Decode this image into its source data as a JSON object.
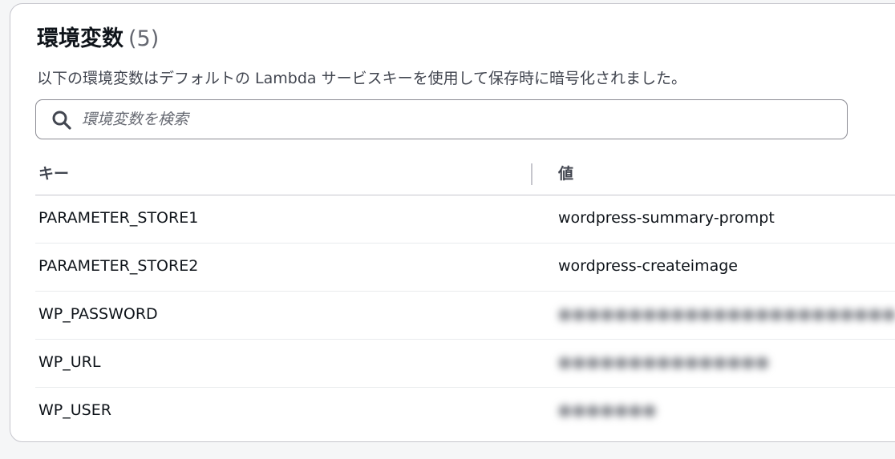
{
  "section": {
    "title": "環境変数",
    "count": "(5)",
    "description": "以下の環境変数はデフォルトの Lambda サービスキーを使用して保存時に暗号化されました。"
  },
  "search": {
    "placeholder": "環境変数を検索",
    "value": ""
  },
  "table": {
    "columns": [
      "キー",
      "値"
    ],
    "rows": [
      {
        "key": "PARAMETER_STORE1",
        "value": "wordpress-summary-prompt",
        "redacted": false
      },
      {
        "key": "PARAMETER_STORE2",
        "value": "wordpress-createimage",
        "redacted": false
      },
      {
        "key": "WP_PASSWORD",
        "value": "",
        "redacted": true
      },
      {
        "key": "WP_URL",
        "value": "",
        "redacted": true
      },
      {
        "key": "WP_USER",
        "value": "",
        "redacted": true
      }
    ]
  },
  "icons": {
    "search": "search-icon"
  },
  "colors": {
    "text": "#0f141a",
    "secondary_text": "#656871",
    "border": "#c6c6cd"
  }
}
